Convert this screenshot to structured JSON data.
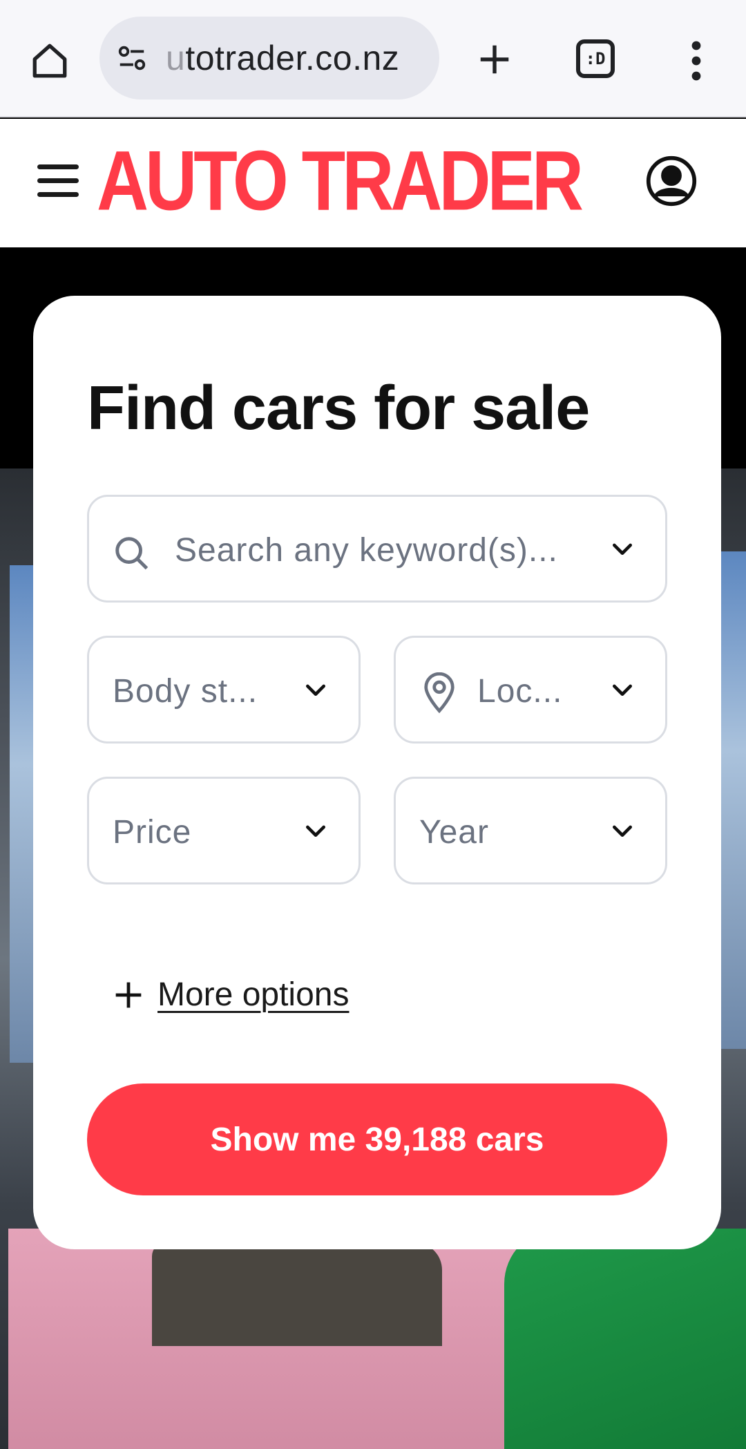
{
  "browser": {
    "url_faded": "u",
    "url_main": "totrader.co.nz",
    "tabs_label": ":D"
  },
  "header": {
    "logo_text": "AUTO TRADER"
  },
  "search_card": {
    "title": "Find cars for sale",
    "keyword_placeholder": "Search any keyword(s)...",
    "body_style_label": "Body st...",
    "location_label": "Loc...",
    "price_label": "Price",
    "year_label": "Year",
    "more_options_label": "More options",
    "cta_label": "Show me 39,188 cars"
  },
  "colors": {
    "brand_red": "#ff3b48",
    "field_border": "#dadde3",
    "placeholder_text": "#6b7280"
  }
}
